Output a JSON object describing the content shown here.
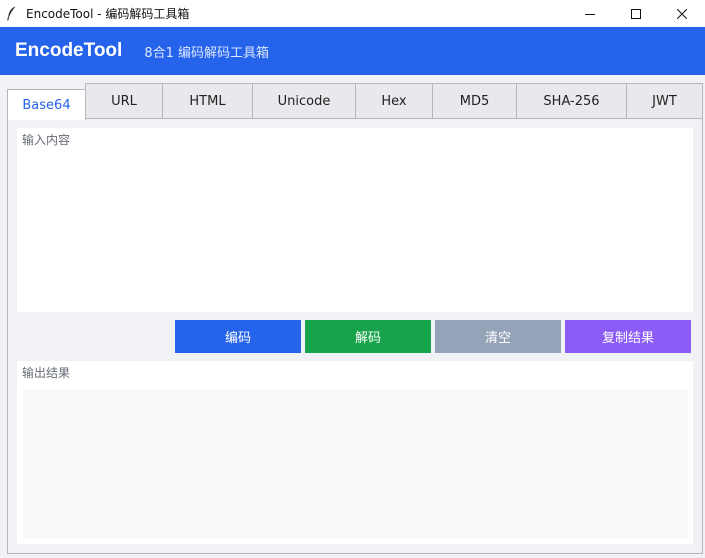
{
  "window": {
    "title": "EncodeTool - 编码解码工具箱"
  },
  "header": {
    "brand": "EncodeTool",
    "subtitle": "8合1 编码解码工具箱"
  },
  "tabs": [
    {
      "label": "Base64",
      "active": true
    },
    {
      "label": "URL",
      "active": false
    },
    {
      "label": "HTML",
      "active": false
    },
    {
      "label": "Unicode",
      "active": false
    },
    {
      "label": "Hex",
      "active": false
    },
    {
      "label": "MD5",
      "active": false
    },
    {
      "label": "SHA-256",
      "active": false
    },
    {
      "label": "JWT",
      "active": false
    }
  ],
  "input": {
    "label": "输入内容",
    "value": ""
  },
  "actions": {
    "encode": {
      "label": "编码",
      "color": "#2563eb"
    },
    "decode": {
      "label": "解码",
      "color": "#16a34a"
    },
    "clear": {
      "label": "清空",
      "color": "#94a3b8"
    },
    "copy": {
      "label": "复制结果",
      "color": "#8b5cf6"
    }
  },
  "output": {
    "label": "输出结果",
    "value": ""
  },
  "colors": {
    "accent": "#2563eb",
    "header_bg": "#2563eb",
    "panel_bg": "#f1f2f5"
  }
}
